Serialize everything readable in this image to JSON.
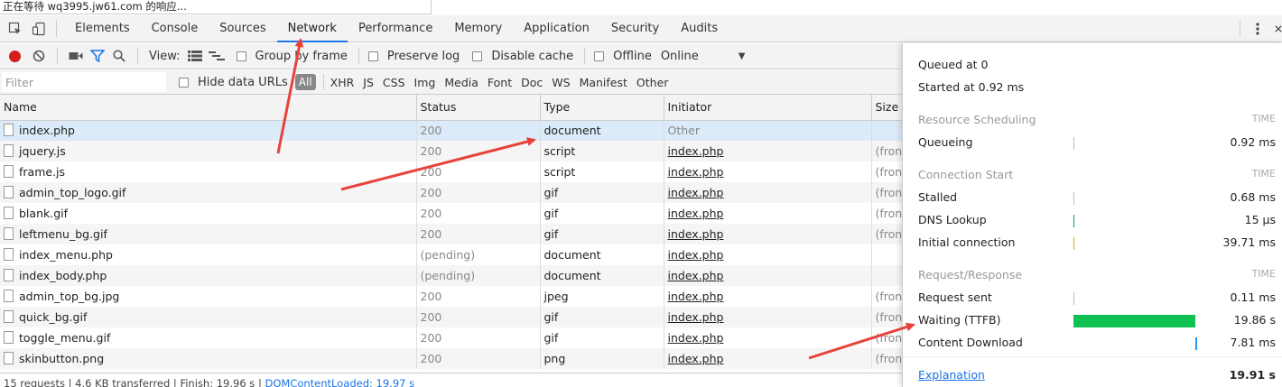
{
  "browser_status": "正在等待 wq3995.jw61.com 的响应...",
  "tabs": [
    "Elements",
    "Console",
    "Sources",
    "Network",
    "Performance",
    "Memory",
    "Application",
    "Security",
    "Audits"
  ],
  "active_tab": "Network",
  "toolbar": {
    "view_label": "View:",
    "group_by_frame": "Group by frame",
    "preserve_log": "Preserve log",
    "disable_cache": "Disable cache",
    "offline": "Offline",
    "throttle": "Online"
  },
  "filter": {
    "placeholder": "Filter",
    "hide_data_urls": "Hide data URLs",
    "all": "All",
    "types": [
      "XHR",
      "JS",
      "CSS",
      "Img",
      "Media",
      "Font",
      "Doc",
      "WS",
      "Manifest",
      "Other"
    ]
  },
  "table": {
    "columns": [
      "Name",
      "Status",
      "Type",
      "Initiator",
      "Size"
    ],
    "rows": [
      {
        "name": "index.php",
        "status": "200",
        "type": "document",
        "initiator": "Other",
        "size": ""
      },
      {
        "name": "jquery.js",
        "status": "200",
        "type": "script",
        "initiator": "index.php",
        "size": "(fron"
      },
      {
        "name": "frame.js",
        "status": "200",
        "type": "script",
        "initiator": "index.php",
        "size": "(fron"
      },
      {
        "name": "admin_top_logo.gif",
        "status": "200",
        "type": "gif",
        "initiator": "index.php",
        "size": "(fron"
      },
      {
        "name": "blank.gif",
        "status": "200",
        "type": "gif",
        "initiator": "index.php",
        "size": "(fron"
      },
      {
        "name": "leftmenu_bg.gif",
        "status": "200",
        "type": "gif",
        "initiator": "index.php",
        "size": "(fron"
      },
      {
        "name": "index_menu.php",
        "status": "(pending)",
        "type": "document",
        "initiator": "index.php",
        "size": ""
      },
      {
        "name": "index_body.php",
        "status": "(pending)",
        "type": "document",
        "initiator": "index.php",
        "size": ""
      },
      {
        "name": "admin_top_bg.jpg",
        "status": "200",
        "type": "jpeg",
        "initiator": "index.php",
        "size": "(fron"
      },
      {
        "name": "quick_bg.gif",
        "status": "200",
        "type": "gif",
        "initiator": "index.php",
        "size": "(fron"
      },
      {
        "name": "toggle_menu.gif",
        "status": "200",
        "type": "gif",
        "initiator": "index.php",
        "size": "(fron"
      },
      {
        "name": "skinbutton.png",
        "status": "200",
        "type": "png",
        "initiator": "index.php",
        "size": "(fron"
      }
    ]
  },
  "statusbar": {
    "summary": "15 requests | 4.6 KB transferred | Finish: 19.96 s | ",
    "dom_loaded": "DOMContentLoaded: 19.97 s"
  },
  "timing": {
    "queued_at": "Queued at 0",
    "started_at": "Started at 0.92 ms",
    "time_header": "TIME",
    "sections": [
      {
        "title": "Resource Scheduling",
        "rows": [
          {
            "label": "Queueing",
            "value": "0.92 ms"
          }
        ]
      },
      {
        "title": "Connection Start",
        "rows": [
          {
            "label": "Stalled",
            "value": "0.68 ms"
          },
          {
            "label": "DNS Lookup",
            "value": "15 µs"
          },
          {
            "label": "Initial connection",
            "value": "39.71 ms"
          }
        ]
      },
      {
        "title": "Request/Response",
        "rows": [
          {
            "label": "Request sent",
            "value": "0.11 ms"
          },
          {
            "label": "Waiting (TTFB)",
            "value": "19.86 s"
          },
          {
            "label": "Content Download",
            "value": "7.81 ms"
          }
        ]
      }
    ],
    "explanation": "Explanation",
    "total": "19.91 s",
    "colors": {
      "dns": "#009688",
      "connect": "#e2a400",
      "ttfb": "#0fc150",
      "download": "#2196f3",
      "stalled": "#bbbbbb"
    }
  },
  "annotation_color": "#e8423a"
}
